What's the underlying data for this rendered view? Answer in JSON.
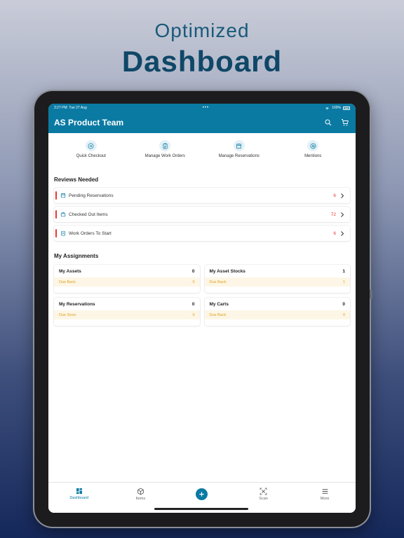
{
  "hero": {
    "line1": "Optimized",
    "line2": "Dashboard"
  },
  "status": {
    "time": "3:27 PM",
    "date": "Tue 27 Aug",
    "dots": "•••",
    "battery": "100%"
  },
  "app": {
    "title": "AS Product Team"
  },
  "quick_actions": [
    {
      "label": "Quick Checkout",
      "icon": "checkout-arrow-icon"
    },
    {
      "label": "Manage Work Orders",
      "icon": "clipboard-icon"
    },
    {
      "label": "Manage Reservations",
      "icon": "calendar-icon"
    },
    {
      "label": "Mentions",
      "icon": "at-icon"
    }
  ],
  "reviews": {
    "title": "Reviews Needed",
    "items": [
      {
        "label": "Pending Reservations",
        "count": "6"
      },
      {
        "label": "Checked Out Items",
        "count": "72"
      },
      {
        "label": "Work Orders To Start",
        "count": "6"
      }
    ]
  },
  "assignments": {
    "title": "My Assignments",
    "cards": [
      {
        "title": "My Assets",
        "count": "0",
        "sub_label": "Due Back",
        "sub_count": "0"
      },
      {
        "title": "My Asset Stocks",
        "count": "1",
        "sub_label": "Due Back",
        "sub_count": "1"
      },
      {
        "title": "My Reservations",
        "count": "0",
        "sub_label": "Due Soon",
        "sub_count": "0"
      },
      {
        "title": "My Carts",
        "count": "0",
        "sub_label": "Due Back",
        "sub_count": "0"
      }
    ]
  },
  "tabs": [
    {
      "label": "Dashboard",
      "icon": "dashboard-icon"
    },
    {
      "label": "Items",
      "icon": "box-icon"
    },
    {
      "label": "",
      "icon": "plus-icon"
    },
    {
      "label": "Scan",
      "icon": "scan-icon"
    },
    {
      "label": "More",
      "icon": "menu-icon"
    }
  ],
  "colors": {
    "primary": "#0a7aa3",
    "alert": "#e53935",
    "warning": "#e0a11c"
  }
}
